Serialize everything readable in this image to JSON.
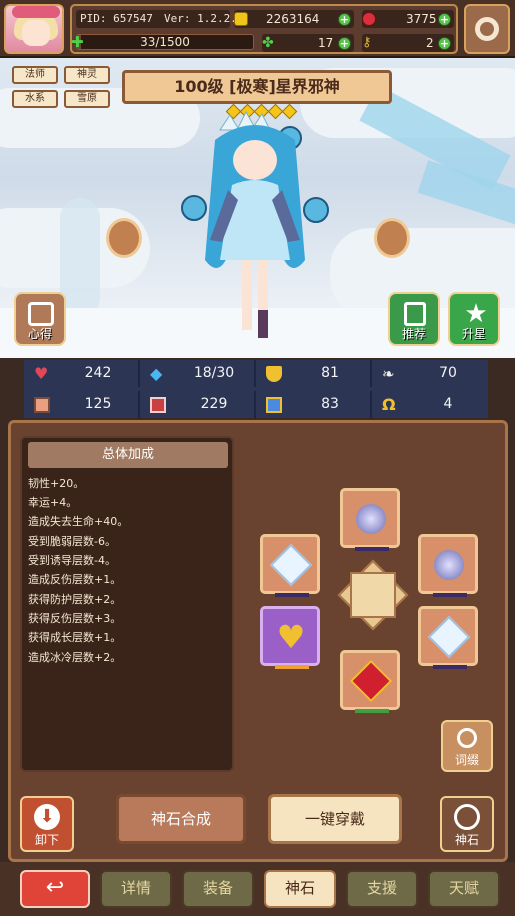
{
  "header": {
    "pid": "PID: 657547",
    "version": "Ver: 1.2.2.0",
    "gold": "2263164",
    "rubies": "3775",
    "exp": "33/1500",
    "exp_fraction": 0.022,
    "clover": "17",
    "keys": "2"
  },
  "hero": {
    "title": "100级 [极寒]星界邪神",
    "stars": 5,
    "tags": [
      "法师",
      "神灵",
      "水系",
      "雪原"
    ]
  },
  "actions": {
    "insight": "心得",
    "recommend": "推荐",
    "upgrade": "升星"
  },
  "stats": [
    {
      "icon": "heart-icon",
      "value": "242"
    },
    {
      "icon": "drop-icon",
      "value": "18/30"
    },
    {
      "icon": "shield-icon",
      "value": "81"
    },
    {
      "icon": "wing-icon",
      "value": "70"
    },
    {
      "icon": "armor-icon",
      "value": "125"
    },
    {
      "icon": "book-icon",
      "value": "229"
    },
    {
      "icon": "scroll-icon",
      "value": "83"
    },
    {
      "icon": "horseshoe-icon",
      "value": "4"
    }
  ],
  "bonus": {
    "title": "总体加成",
    "lines": [
      "韧性+20。",
      "幸运+4。",
      "造成失去生命+40。",
      "受到脆弱层数-6。",
      "受到诱导层数-4。",
      "造成反伤层数+1。",
      "获得防护层数+2。",
      "获得反伤层数+3。",
      "获得成长层数+1。",
      "造成冰冷层数+2。"
    ]
  },
  "word_button": "词缀",
  "buttons": {
    "unequip": "卸下",
    "synthesize": "神石合成",
    "equip_all": "一键穿戴",
    "godstone": "神石"
  },
  "tabs": [
    "详情",
    "装备",
    "神石",
    "支援",
    "天赋"
  ],
  "active_tab": "神石",
  "colors": {
    "panel": "#6a4230",
    "stats_bar": "#2c3554",
    "accent_gold": "#f0c896",
    "back_button": "#e04438"
  }
}
